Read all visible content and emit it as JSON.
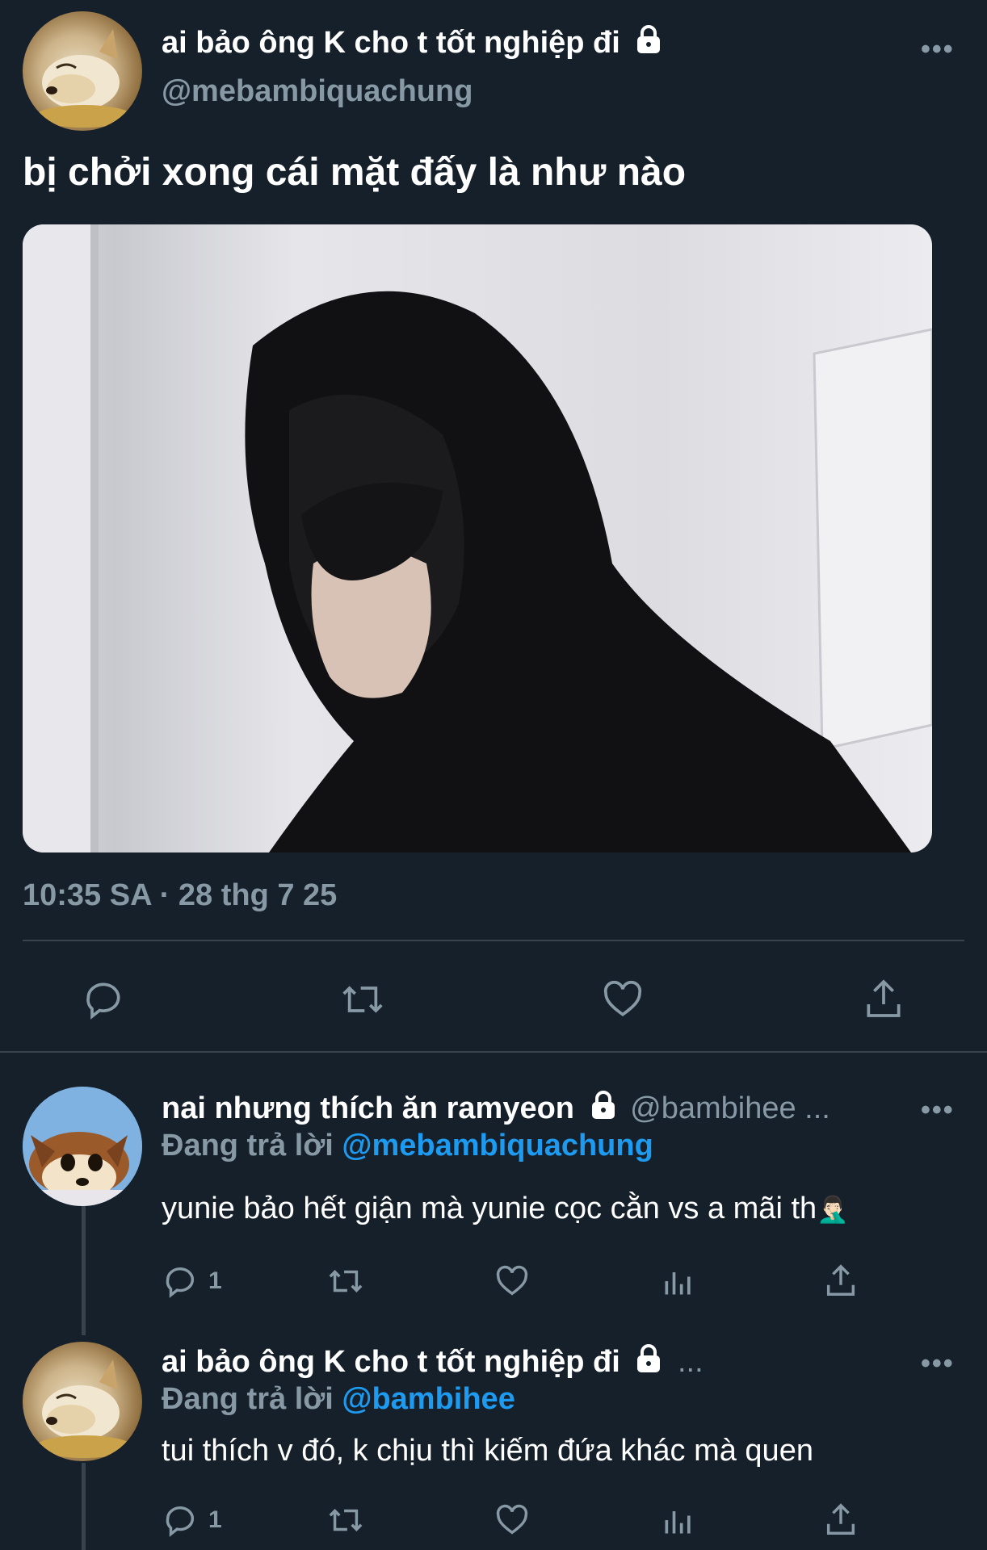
{
  "main_tweet": {
    "display_name": "ai bảo ông K cho t tốt nghiệp đi",
    "handle": "@mebambiquachung",
    "text": "bị chởi xong cái mặt đấy là như nào",
    "timestamp": "10:35 SA · 28 thg 7 25",
    "more_label": "•••"
  },
  "replies": [
    {
      "display_name": "nai nhưng thích ăn ramyeon",
      "handle": "@bambihee ...",
      "replying_prefix": "Đang trả lời",
      "replying_to": "@mebambiquachung",
      "text": "yunie bảo hết giận mà yunie cọc cằn vs a mãi th",
      "emoji": "🤦🏻‍♂️",
      "reply_count": "1",
      "more_label": "•••"
    },
    {
      "display_name": "ai bảo ông K cho t tốt nghiệp đi",
      "handle": "...",
      "replying_prefix": "Đang trả lời",
      "replying_to": "@bambihee",
      "text": "tui thích v đó, k chịu thì kiếm đứa khác mà quen",
      "reply_count": "1",
      "more_label": "•••"
    }
  ],
  "colors": {
    "background": "#15202b",
    "muted": "#8899a6",
    "link": "#1d9bf0",
    "divider": "#38444d"
  },
  "icons": [
    "lock-icon",
    "reply-icon",
    "retweet-icon",
    "like-icon",
    "share-icon",
    "analytics-icon",
    "more-icon"
  ]
}
